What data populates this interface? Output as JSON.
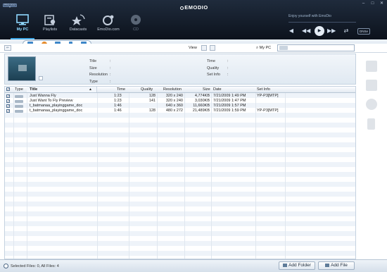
{
  "app": {
    "badge": "PRO 2012 ▾",
    "brand": "EMODIO"
  },
  "window": {
    "minimize": "–",
    "maximize": "□",
    "close": "✕"
  },
  "nav": [
    {
      "label": "My PC",
      "icon": "monitor-icon",
      "active": true
    },
    {
      "label": "Playlists",
      "icon": "playlist-icon",
      "active": false
    },
    {
      "label": "Datacasts",
      "icon": "datacast-icon",
      "active": false
    },
    {
      "label": "EmoDio.com",
      "icon": "web-icon",
      "active": false
    },
    {
      "label": "CD",
      "icon": "disc-icon",
      "active": false
    }
  ],
  "player": {
    "tagline": "Enjoy yourself with EmoDio",
    "volume": "◀",
    "prev": "◀◀",
    "play": "▶",
    "next": "▶▶",
    "repeat": "⇄",
    "dns": "DNSe"
  },
  "subtabs": [
    "music-icon",
    "photo-icon",
    "video-icon",
    "voice-icon",
    "folder-icon"
  ],
  "toolbar": {
    "back": "⇐",
    "view_label": "View",
    "search_label": "My PC"
  },
  "info": {
    "title": "Title",
    "size": "Size",
    "resolution": "Resolution",
    "type": "Type",
    "time": "Time",
    "quality": "Quality",
    "set_info": "Set Info",
    "sep": ":"
  },
  "table": {
    "headers": {
      "type": "Type",
      "title": "Title",
      "time": "Time",
      "quality": "Quality",
      "resolution": "Resolution",
      "size": "Size",
      "date": "Date",
      "set_info": "Set Info"
    },
    "rows": [
      {
        "checked": true,
        "title": "Just Wanna Fly",
        "time": "1:23",
        "quality": "128",
        "resolution": "320 x 240",
        "size": "4,774KB",
        "date": "7/21/2009 1:49 PM",
        "set_info": "YP-P3[MTP]"
      },
      {
        "checked": true,
        "title": "Just Want To Fly Preview",
        "time": "1:23",
        "quality": "141",
        "resolution": "320 x 240",
        "size": "3,030KB",
        "date": "7/21/2009 1:47 PM",
        "set_info": ""
      },
      {
        "checked": true,
        "title": "t_batmanaa_playinggame_doc",
        "time": "1:46",
        "quality": "",
        "resolution": "640 x 360",
        "size": "11,660KB",
        "date": "7/21/2009 1:57 PM",
        "set_info": ""
      },
      {
        "checked": true,
        "title": "t_batmanaa_playinggame_doc",
        "time": "1:46",
        "quality": "128",
        "resolution": "480 x 272",
        "size": "21,489KB",
        "date": "7/21/2009 1:59 PM",
        "set_info": "YP-P3[MTP]"
      }
    ]
  },
  "side_panel": [
    "sync-icon",
    "convert-icon",
    "burn-icon",
    "device-icon"
  ],
  "status": {
    "text": "Selected Files: 0, All Files: 4",
    "add_folder": "Add Folder",
    "add_file": "Add File"
  }
}
